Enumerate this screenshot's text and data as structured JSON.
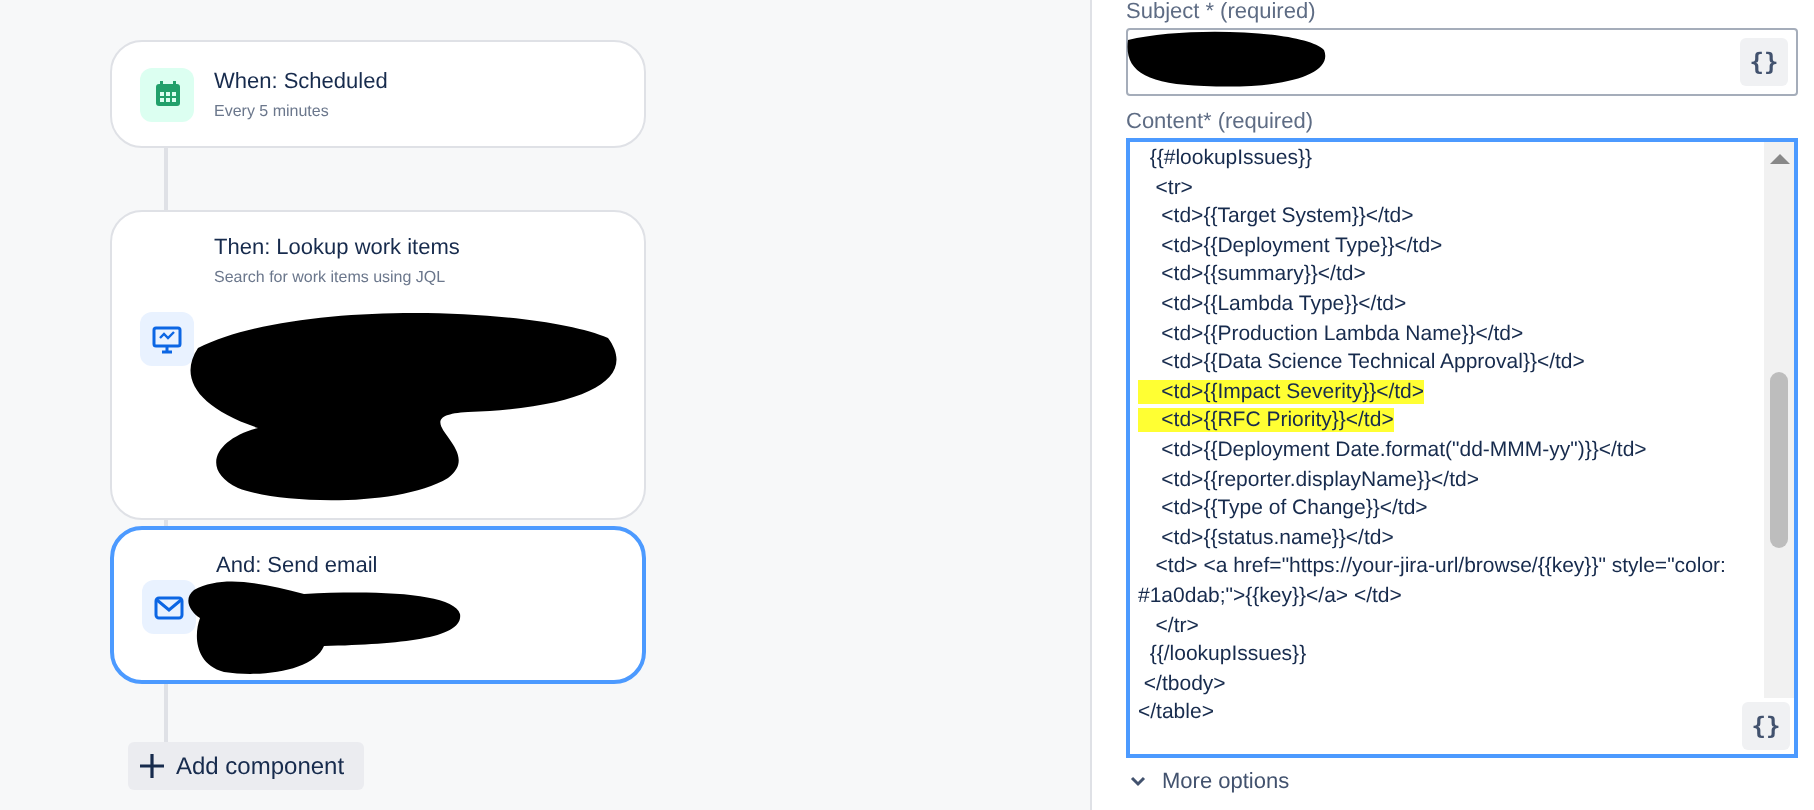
{
  "flow": {
    "cards": [
      {
        "kind": "schedule",
        "title": "When: Scheduled",
        "subtitle": "Every 5 minutes",
        "selected": false
      },
      {
        "kind": "lookup",
        "title": "Then: Lookup work items",
        "subtitle": "Search for work items using JQL",
        "selected": false,
        "redacted": true
      },
      {
        "kind": "email",
        "title": "And: Send email",
        "selected": true,
        "redacted": true
      }
    ],
    "add_button": {
      "label": "Add component"
    }
  },
  "panel": {
    "subject": {
      "label": "Subject",
      "required_mark": "*",
      "hint": "(required)",
      "redacted": true
    },
    "content": {
      "label": "Content",
      "required_mark": "*",
      "hint": "(required)",
      "lines": [
        {
          "text": "  {{#lookupIssues}}",
          "highlighted": false
        },
        {
          "text": "   <tr>",
          "highlighted": false
        },
        {
          "text": "    <td>{{Target System}}</td>",
          "highlighted": false
        },
        {
          "text": "    <td>{{Deployment Type}}</td>",
          "highlighted": false
        },
        {
          "text": "    <td>{{summary}}</td>",
          "highlighted": false
        },
        {
          "text": "    <td>{{Lambda Type}}</td>",
          "highlighted": false
        },
        {
          "text": "    <td>{{Production Lambda Name}}</td>",
          "highlighted": false
        },
        {
          "text": "    <td>{{Data Science Technical Approval}}</td>",
          "highlighted": false
        },
        {
          "text": "    <td>{{Impact Severity}}</td>",
          "highlighted": true
        },
        {
          "text": "    <td>{{RFC Priority}}</td>",
          "highlighted": true
        },
        {
          "text": "    <td>{{Deployment Date.format(\"dd-MMM-yy\")}}</td>",
          "highlighted": false
        },
        {
          "text": "    <td>{{reporter.displayName}}</td>",
          "highlighted": false
        },
        {
          "text": "    <td>{{Type of Change}}</td>",
          "highlighted": false
        },
        {
          "text": "    <td>{{status.name}}</td>",
          "highlighted": false
        },
        {
          "text": "   <td> <a href=\"https://your-jira-url/browse/{{key}}\" style=\"color:",
          "highlighted": false
        },
        {
          "text": "#1a0dab;\">{{key}}</a> </td>",
          "highlighted": false
        },
        {
          "text": "   </tr>",
          "highlighted": false
        },
        {
          "text": "  {{/lookupIssues}}",
          "highlighted": false
        },
        {
          "text": " </tbody>",
          "highlighted": false
        },
        {
          "text": "</table>",
          "highlighted": false
        }
      ]
    },
    "smart_value_button": "{}",
    "more_options": "More options"
  }
}
